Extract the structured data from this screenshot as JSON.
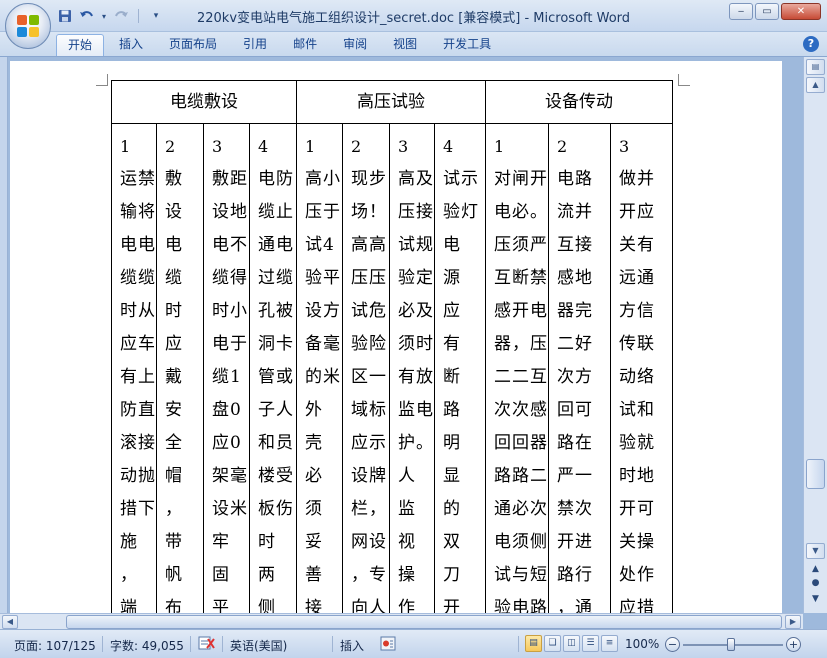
{
  "window": {
    "title": "220kv变电站电气施工组织设计_secret.doc [兼容模式] - Microsoft Word",
    "minimize": "‒",
    "maximize": "▭",
    "close": "✕"
  },
  "qat": {
    "save_icon": "save-icon",
    "undo_icon": "undo-icon",
    "redo_icon": "redo-icon",
    "customize_icon": "customize-qat-icon"
  },
  "ribbon": {
    "tabs": [
      "开始",
      "插入",
      "页面布局",
      "引用",
      "邮件",
      "审阅",
      "视图",
      "开发工具"
    ],
    "active_tab": "开始",
    "help": "?"
  },
  "document": {
    "headers": [
      "电缆敷设",
      "高压试验",
      "设备传动"
    ],
    "columns": [
      {
        "num": "1",
        "lines": [
          "运禁",
          "输将",
          "电电",
          "缆缆",
          "时从",
          "应车",
          "有上",
          "防直",
          "滚接",
          "动抛",
          "措下",
          "施",
          "，",
          "端"
        ]
      },
      {
        "num": "2",
        "lines": [
          "敷",
          "设",
          "电",
          "缆",
          "时",
          "应",
          "戴",
          "安",
          "全",
          "帽",
          "，",
          "带",
          "帆",
          "布"
        ]
      },
      {
        "num": "3",
        "lines": [
          "敷距",
          "设地",
          "电不",
          "缆得",
          "时小",
          "电于",
          "缆1",
          "盘0",
          "应0",
          "架毫",
          "设米",
          "牢",
          "固",
          "平"
        ]
      },
      {
        "num": "4",
        "lines": [
          "电防",
          "缆止",
          "通电",
          "过缆",
          "孔被",
          "洞卡",
          "管或",
          "子人",
          "和员",
          "楼受",
          "板伤",
          "时",
          "两",
          "侧"
        ]
      },
      {
        "num": "1",
        "lines": [
          "高小",
          "压于",
          "试4",
          "验平",
          "设方",
          "备毫",
          "的米",
          "外",
          "壳",
          "必",
          "须",
          "妥",
          "善",
          "接"
        ]
      },
      {
        "num": "2",
        "lines": [
          "现步",
          "场！",
          "高高",
          "压压",
          "试危",
          "验险",
          "区一",
          "域标",
          "应示",
          "设牌",
          "栏，",
          "网设",
          "，专",
          "向人"
        ]
      },
      {
        "num": "3",
        "lines": [
          "高及",
          "压接",
          "试规",
          "验定",
          "必及",
          "须时",
          "有放",
          "监电",
          "护。",
          "人",
          "监",
          "视",
          "操",
          "作"
        ]
      },
      {
        "num": "4",
        "lines": [
          "试示",
          "验灯",
          "电",
          "源",
          "应",
          "有",
          "断",
          "路",
          "明",
          "显",
          "的",
          "双",
          "刀",
          "开"
        ]
      },
      {
        "num": "1",
        "lines": [
          "对闸开",
          "电必。",
          "压须严",
          "互断禁",
          "感开电",
          "器，压",
          "二二互",
          "次次感",
          "回回器",
          "路路二",
          "通必次",
          "电须侧",
          "试与短",
          "验电路"
        ]
      },
      {
        "num": "2",
        "lines": [
          "电路",
          "流并",
          "互接",
          "感地",
          "器完",
          "二好",
          "次方",
          "回可",
          "路在",
          "严一",
          "禁次",
          "开进",
          "路行",
          "，通"
        ]
      },
      {
        "num": "3",
        "lines": [
          "做并",
          "开应",
          "关有",
          "远通",
          "方信",
          "传联",
          "动络",
          "试和",
          "验就",
          "时地",
          "开可",
          "关操",
          "处作",
          "应措"
        ]
      }
    ]
  },
  "statusbar": {
    "page": "页面: 107/125",
    "words": "字数: 49,055",
    "language": "英语(美国)",
    "insert_mode": "插入",
    "zoom": "100%",
    "zoom_out": "−",
    "zoom_in": "+"
  },
  "colors": {
    "frame": "#9eb9dc",
    "ribbon_text": "#15428b",
    "page": "#ffffff"
  }
}
